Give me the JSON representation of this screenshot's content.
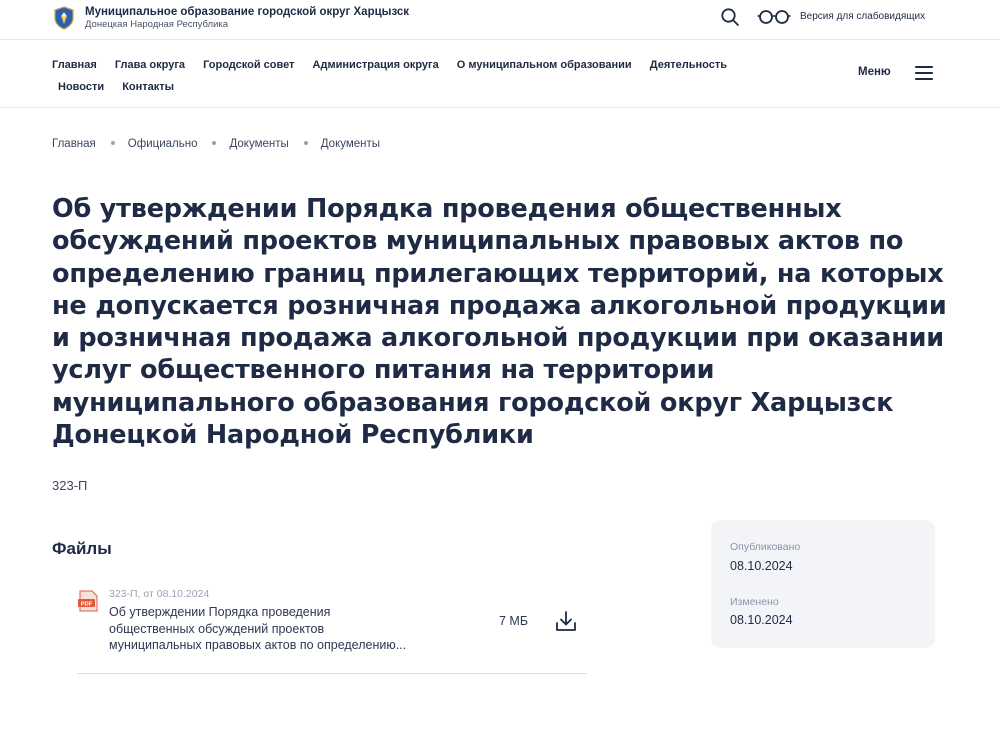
{
  "header": {
    "org_title": "Муниципальное образование городской округ Харцызск",
    "org_subtitle": "Донецкая Народная Республика",
    "vision_link": "Версия для слабовидящих",
    "logo_icon": "coat-of-arms-icon",
    "search_icon": "search-icon",
    "glasses_icon": "glasses-icon"
  },
  "nav": {
    "row1": [
      "Главная",
      "Глава округа",
      "Городской совет",
      "Администрация округа",
      "О муниципальном образовании",
      "Деятельность"
    ],
    "row2": [
      "Новости",
      "Контакты"
    ],
    "menu_label": "Меню"
  },
  "breadcrumb": [
    "Главная",
    "Официально",
    "Документы",
    "Документы"
  ],
  "document": {
    "title_lines": [
      "Об утверждении Порядка проведения общественных",
      "обсуждений проектов муниципальных правовых актов по",
      "определению границ прилегающих территорий, на которых",
      "не допускается розничная продажа алкогольной продукции",
      "и розничная продажа алкогольной продукции при оказании",
      "услуг общественного питания на территории",
      "муниципального образования городской округ Харцызск",
      "Донецкой Народной Республики"
    ],
    "number": "323-П"
  },
  "files": {
    "heading": "Файлы",
    "items": [
      {
        "icon": "pdf-icon",
        "meta": "323-П, от 08.10.2024",
        "desc_lines": [
          "Об утверждении Порядка проведения",
          "общественных обсуждений проектов",
          "муниципальных правовых актов по определению..."
        ],
        "size": "7 МБ",
        "download_icon": "download-icon"
      }
    ]
  },
  "info": {
    "published_label": "Опубликовано",
    "published_value": "08.10.2024",
    "modified_label": "Изменено",
    "modified_value": "08.10.2024"
  },
  "colors": {
    "text": "#1f2a44",
    "card_bg": "#f2f4f8",
    "pdf_red": "#e05a3a"
  }
}
